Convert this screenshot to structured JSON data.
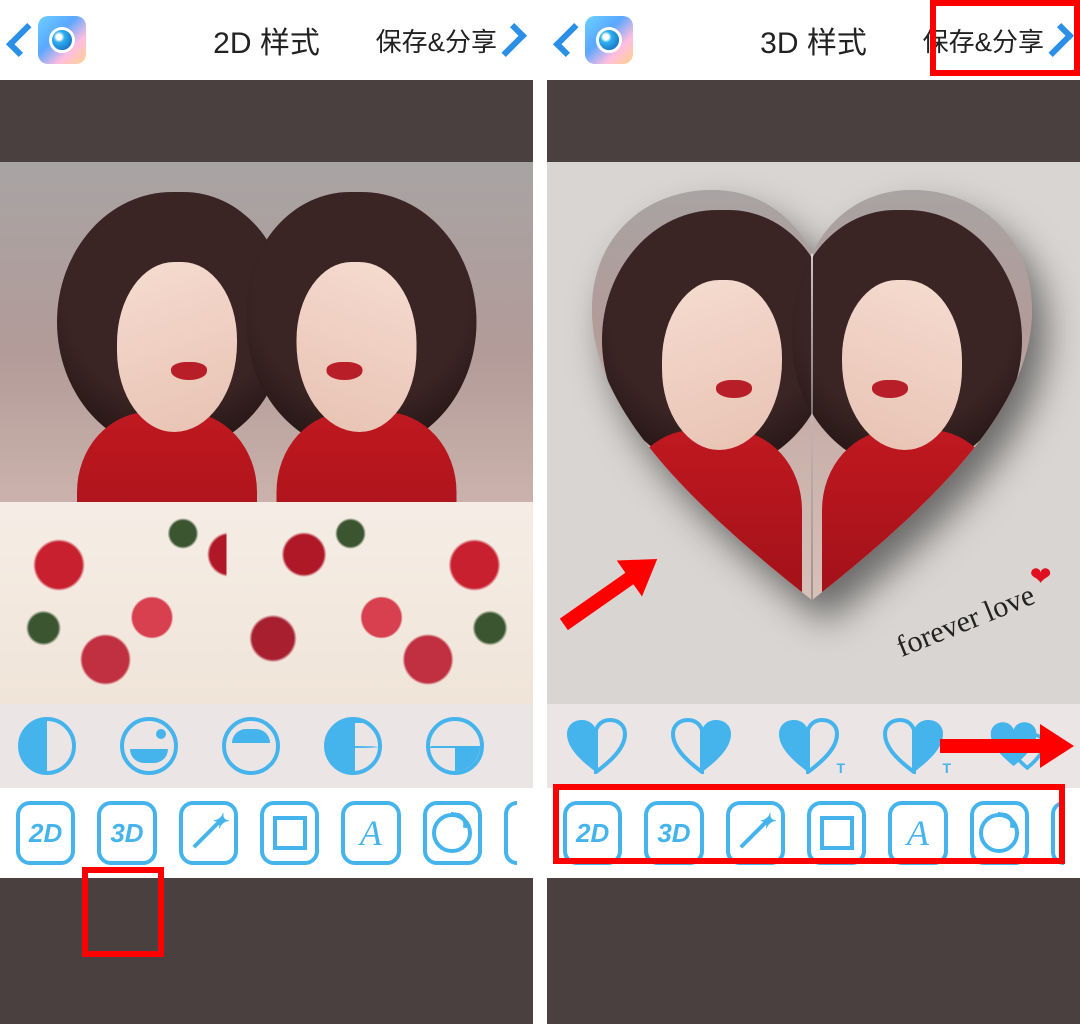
{
  "accent_color": "#45b4ec",
  "annotation_color": "#ff0000",
  "left_panel": {
    "title": "2D 样式",
    "save_share_label": "保存&分享",
    "mode_2d_label": "2D",
    "mode_3d_label": "3D",
    "style_options": [
      "half-circle-vertical",
      "half-circle-bottom-dot",
      "half-circle-top",
      "quadrants-left-filled",
      "quadrants-diagonal"
    ],
    "tool_buttons": [
      {
        "id": "2d",
        "label": "2D"
      },
      {
        "id": "3d",
        "label": "3D"
      },
      {
        "id": "magic",
        "label": ""
      },
      {
        "id": "frame",
        "label": ""
      },
      {
        "id": "font",
        "label": "A"
      },
      {
        "id": "sticker",
        "label": ""
      },
      {
        "id": "more",
        "label": ""
      }
    ]
  },
  "right_panel": {
    "title": "3D 样式",
    "save_share_label": "保存&分享",
    "overlay_text": "forever love",
    "mode_2d_label": "2D",
    "mode_3d_label": "3D",
    "style_options": [
      "heart-fold-left-filled",
      "heart-fold-right-filled",
      "heart-fold-left-filled-text",
      "heart-fold-right-filled-text",
      "heart-double"
    ],
    "tool_buttons": [
      {
        "id": "2d",
        "label": "2D"
      },
      {
        "id": "3d",
        "label": "3D"
      },
      {
        "id": "magic",
        "label": ""
      },
      {
        "id": "frame",
        "label": ""
      },
      {
        "id": "font",
        "label": "A"
      },
      {
        "id": "sticker",
        "label": ""
      },
      {
        "id": "more",
        "label": ""
      }
    ]
  }
}
